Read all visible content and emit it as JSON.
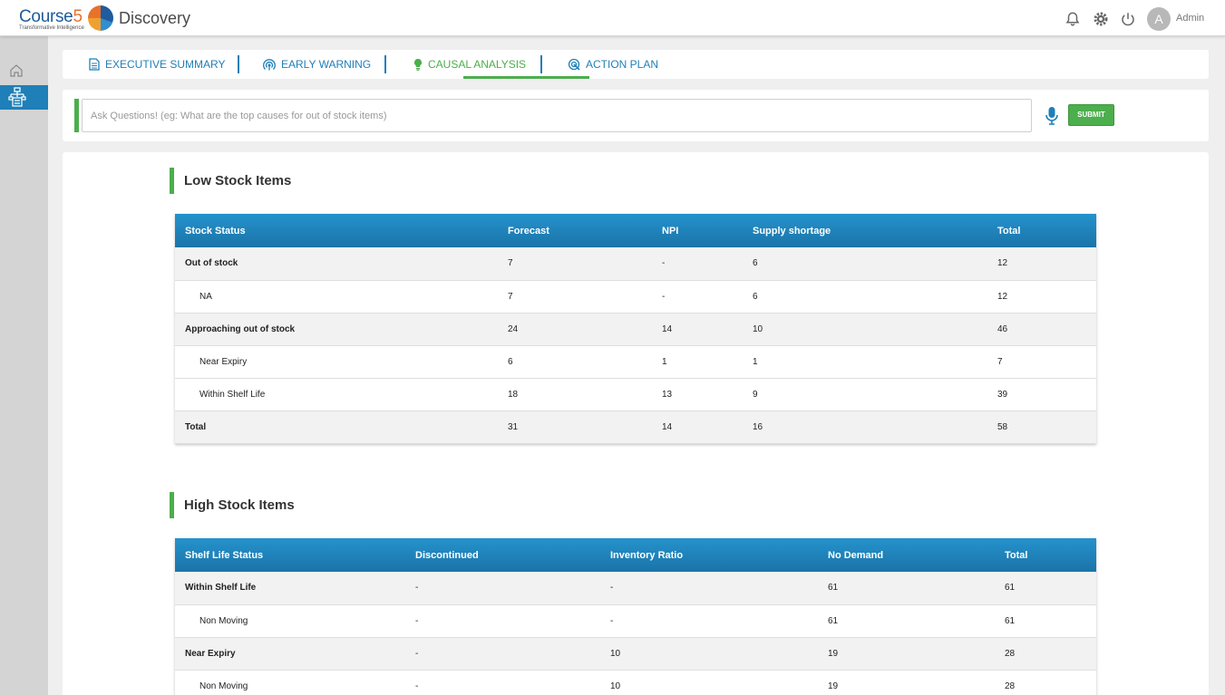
{
  "app": {
    "logo_name": "Course",
    "logo_number": "5",
    "logo_tagline": "Transformative Intelligence",
    "title": "Discovery",
    "user_initial": "A",
    "user_name": "Admin"
  },
  "tabs": [
    {
      "label": "EXECUTIVE SUMMARY",
      "icon": "document-icon"
    },
    {
      "label": "EARLY WARNING",
      "icon": "signal-icon"
    },
    {
      "label": "CAUSAL ANALYSIS",
      "icon": "lightbulb-icon",
      "active": true
    },
    {
      "label": "ACTION PLAN",
      "icon": "target-icon"
    }
  ],
  "question": {
    "placeholder": "Ask Questions! (eg: What are the top causes for out of stock items)",
    "submit_label": "SUBMIT"
  },
  "colors": {
    "accent_green": "#4cae4c",
    "brand_blue": "#1f7fb8"
  },
  "low_stock": {
    "title": "Low Stock Items",
    "headers": [
      "Stock Status",
      "Forecast",
      "NPI",
      "Supply shortage",
      "Total"
    ],
    "rows": [
      {
        "cells": [
          "Out of stock",
          "7",
          "-",
          "6",
          "12"
        ],
        "level": "parent"
      },
      {
        "cells": [
          "NA",
          "7",
          "-",
          "6",
          "12"
        ],
        "level": "child"
      },
      {
        "cells": [
          "Approaching out of stock",
          "24",
          "14",
          "10",
          "46"
        ],
        "level": "parent"
      },
      {
        "cells": [
          "Near Expiry",
          "6",
          "1",
          "1",
          "7"
        ],
        "level": "child"
      },
      {
        "cells": [
          "Within Shelf Life",
          "18",
          "13",
          "9",
          "39"
        ],
        "level": "child"
      },
      {
        "cells": [
          "Total",
          "31",
          "14",
          "16",
          "58"
        ],
        "level": "parent"
      }
    ]
  },
  "high_stock": {
    "title": "High Stock Items",
    "headers": [
      "Shelf Life Status",
      "Discontinued",
      "Inventory Ratio",
      "No Demand",
      "Total"
    ],
    "rows": [
      {
        "cells": [
          "Within Shelf Life",
          "-",
          "-",
          "61",
          "61"
        ],
        "level": "parent"
      },
      {
        "cells": [
          "Non Moving",
          "-",
          "-",
          "61",
          "61"
        ],
        "level": "child"
      },
      {
        "cells": [
          "Near Expiry",
          "-",
          "10",
          "19",
          "28"
        ],
        "level": "parent"
      },
      {
        "cells": [
          "Non Moving",
          "-",
          "10",
          "19",
          "28"
        ],
        "level": "child"
      }
    ]
  }
}
